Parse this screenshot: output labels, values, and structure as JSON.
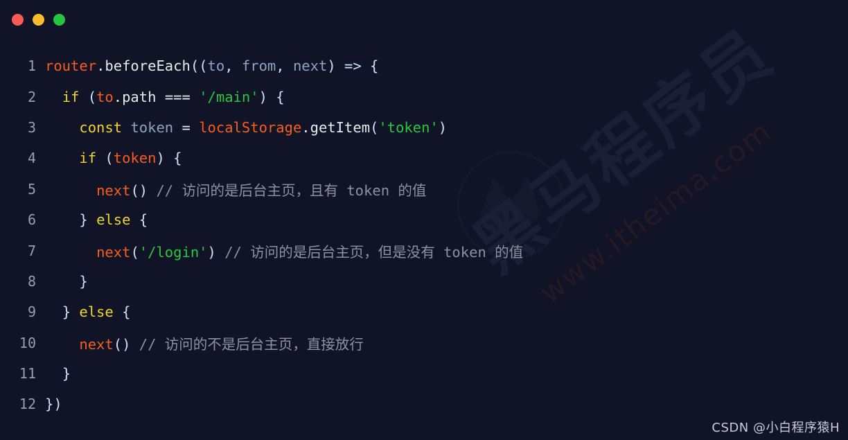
{
  "window": {
    "traffic_lights": [
      {
        "name": "close",
        "color": "#fa5c55"
      },
      {
        "name": "minimize",
        "color": "#f9bd2e"
      },
      {
        "name": "maximize",
        "color": "#25c53f"
      }
    ],
    "background_color": "#101426"
  },
  "background_watermark": {
    "chinese_text": "黑马程序员",
    "url_text": "www.itheima.com"
  },
  "footer_watermark": {
    "text": "CSDN @小白程序猿H"
  },
  "theme": {
    "line_number": "#98a0ae",
    "plain": "#e8eaf0",
    "keyword": "#f2d42c",
    "variable": "#fa5c1e",
    "identifier": "#8ea4c0",
    "punctuation": "#cfe3f5",
    "string": "#28c840",
    "comment": "#8b93a3"
  },
  "code": {
    "language": "javascript",
    "line_count": 12,
    "plain_text": "router.beforeEach((to, from, next) => {\n  if (to.path === '/main') {\n    const token = localStorage.getItem('token')\n    if (token) {\n      next() // 访问的是后台主页，且有 token 的值\n    } else {\n      next('/login') // 访问的是后台主页，但是没有 token 的值\n    }\n  } else {\n    next() // 访问的不是后台主页，直接放行\n  }\n})",
    "lines": [
      {
        "number": "1",
        "indent": 0,
        "tokens": [
          {
            "t": "router",
            "c": "t-var"
          },
          {
            "t": ".beforeEach",
            "c": "t-plain"
          },
          {
            "t": "((",
            "c": "t-punct"
          },
          {
            "t": "to",
            "c": "t-ident"
          },
          {
            "t": ", ",
            "c": "t-punct"
          },
          {
            "t": "from",
            "c": "t-ident"
          },
          {
            "t": ", ",
            "c": "t-punct"
          },
          {
            "t": "next",
            "c": "t-ident"
          },
          {
            "t": ")",
            "c": "t-punct"
          },
          {
            "t": " => ",
            "c": "t-punct"
          },
          {
            "t": "{",
            "c": "t-punct"
          }
        ]
      },
      {
        "number": "2",
        "indent": 1,
        "tokens": [
          {
            "t": "if",
            "c": "t-kw"
          },
          {
            "t": " ",
            "c": "t-plain"
          },
          {
            "t": "(",
            "c": "t-punct"
          },
          {
            "t": "to",
            "c": "t-var"
          },
          {
            "t": ".path",
            "c": "t-plain"
          },
          {
            "t": " ",
            "c": "t-plain"
          },
          {
            "t": "===",
            "c": "t-op"
          },
          {
            "t": " ",
            "c": "t-plain"
          },
          {
            "t": "'/main'",
            "c": "t-str"
          },
          {
            "t": ")",
            "c": "t-punct"
          },
          {
            "t": " ",
            "c": "t-plain"
          },
          {
            "t": "{",
            "c": "t-punct"
          }
        ]
      },
      {
        "number": "3",
        "indent": 2,
        "tokens": [
          {
            "t": "const",
            "c": "t-kw"
          },
          {
            "t": " ",
            "c": "t-plain"
          },
          {
            "t": "token",
            "c": "t-ident"
          },
          {
            "t": " ",
            "c": "t-plain"
          },
          {
            "t": "=",
            "c": "t-op"
          },
          {
            "t": " ",
            "c": "t-plain"
          },
          {
            "t": "localStorage",
            "c": "t-var"
          },
          {
            "t": ".getItem",
            "c": "t-plain"
          },
          {
            "t": "(",
            "c": "t-punct"
          },
          {
            "t": "'token'",
            "c": "t-str"
          },
          {
            "t": ")",
            "c": "t-punct"
          }
        ]
      },
      {
        "number": "4",
        "indent": 2,
        "tokens": [
          {
            "t": "if",
            "c": "t-kw"
          },
          {
            "t": " ",
            "c": "t-plain"
          },
          {
            "t": "(",
            "c": "t-punct"
          },
          {
            "t": "token",
            "c": "t-var"
          },
          {
            "t": ")",
            "c": "t-punct"
          },
          {
            "t": " ",
            "c": "t-plain"
          },
          {
            "t": "{",
            "c": "t-punct"
          }
        ]
      },
      {
        "number": "5",
        "indent": 3,
        "tokens": [
          {
            "t": "next",
            "c": "t-var"
          },
          {
            "t": "()",
            "c": "t-punct"
          },
          {
            "t": " ",
            "c": "t-plain"
          },
          {
            "t": "// 访问的是后台主页，且有 token 的值",
            "c": "t-comment"
          }
        ]
      },
      {
        "number": "6",
        "indent": 2,
        "tokens": [
          {
            "t": "}",
            "c": "t-punct"
          },
          {
            "t": " ",
            "c": "t-plain"
          },
          {
            "t": "else",
            "c": "t-kw"
          },
          {
            "t": " ",
            "c": "t-plain"
          },
          {
            "t": "{",
            "c": "t-punct"
          }
        ]
      },
      {
        "number": "7",
        "indent": 3,
        "tokens": [
          {
            "t": "next",
            "c": "t-var"
          },
          {
            "t": "(",
            "c": "t-punct"
          },
          {
            "t": "'/login'",
            "c": "t-str"
          },
          {
            "t": ")",
            "c": "t-punct"
          },
          {
            "t": " ",
            "c": "t-plain"
          },
          {
            "t": "// 访问的是后台主页，但是没有 token 的值",
            "c": "t-comment"
          }
        ]
      },
      {
        "number": "8",
        "indent": 2,
        "tokens": [
          {
            "t": "}",
            "c": "t-punct"
          }
        ]
      },
      {
        "number": "9",
        "indent": 1,
        "tokens": [
          {
            "t": "}",
            "c": "t-punct"
          },
          {
            "t": " ",
            "c": "t-plain"
          },
          {
            "t": "else",
            "c": "t-kw"
          },
          {
            "t": " ",
            "c": "t-plain"
          },
          {
            "t": "{",
            "c": "t-punct"
          }
        ]
      },
      {
        "number": "10",
        "indent": 2,
        "tokens": [
          {
            "t": "next",
            "c": "t-var"
          },
          {
            "t": "()",
            "c": "t-punct"
          },
          {
            "t": " ",
            "c": "t-plain"
          },
          {
            "t": "// 访问的不是后台主页，直接放行",
            "c": "t-comment"
          }
        ]
      },
      {
        "number": "11",
        "indent": 1,
        "tokens": [
          {
            "t": "}",
            "c": "t-punct"
          }
        ]
      },
      {
        "number": "12",
        "indent": 0,
        "tokens": [
          {
            "t": "})",
            "c": "t-punct"
          }
        ]
      }
    ]
  }
}
